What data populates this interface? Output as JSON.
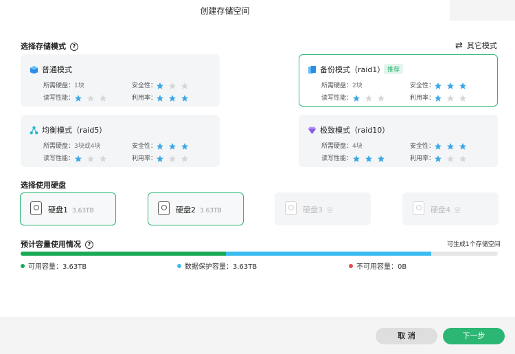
{
  "dialog": {
    "title": "创建存储空间"
  },
  "storage_mode": {
    "label": "选择存储模式",
    "help": "?",
    "other_mode": "其它模式",
    "cards": [
      {
        "name": "普通模式",
        "icon": "cube-icon",
        "selected": false,
        "badge": "",
        "disks_label": "所需硬盘：",
        "disks_value": "1块",
        "security_label": "安全性：",
        "security_stars": 1,
        "rw_label": "读写性能：",
        "rw_stars": 1,
        "util_label": "利用率：",
        "util_stars": 3
      },
      {
        "name": "备份模式（raid1）",
        "icon": "backup-icon",
        "selected": true,
        "badge": "推荐",
        "disks_label": "所需硬盘：",
        "disks_value": "2块",
        "security_label": "安全性：",
        "security_stars": 3,
        "rw_label": "读写性能：",
        "rw_stars": 1,
        "util_label": "利用率：",
        "util_stars": 1
      },
      {
        "name": "均衡模式（raid5）",
        "icon": "network-icon",
        "selected": false,
        "badge": "",
        "disks_label": "所需硬盘：",
        "disks_value": "3块或4块",
        "security_label": "安全性：",
        "security_stars": 3,
        "rw_label": "读写性能：",
        "rw_stars": 1,
        "util_label": "利用率：",
        "util_stars": 1
      },
      {
        "name": "极致模式（raid10）",
        "icon": "gem-icon",
        "selected": false,
        "badge": "",
        "disks_label": "所需硬盘：",
        "disks_value": "4块",
        "security_label": "安全性：",
        "security_stars": 3,
        "rw_label": "读写性能：",
        "rw_stars": 3,
        "util_label": "利用率：",
        "util_stars": 1
      }
    ]
  },
  "disks": {
    "label": "选择使用硬盘",
    "items": [
      {
        "name": "硬盘1",
        "size": "3.63TB",
        "selected": true,
        "empty": false
      },
      {
        "name": "硬盘2",
        "size": "3.63TB",
        "selected": true,
        "empty": false
      },
      {
        "name": "硬盘3",
        "size": "空",
        "selected": false,
        "empty": true
      },
      {
        "name": "硬盘4",
        "size": "空",
        "selected": false,
        "empty": true
      }
    ]
  },
  "capacity": {
    "label": "预计容量使用情况",
    "help": "?",
    "summary": "可生成1个存储空间",
    "segments": [
      {
        "fraction": 0.43,
        "color": "#1aaa55"
      },
      {
        "fraction": 0.43,
        "color": "#3bbbf0"
      }
    ],
    "legend": [
      {
        "text": "可用容量：3.63TB",
        "color": "#1aaa55"
      },
      {
        "text": "数据保护容量：3.63TB",
        "color": "#3bbbf0"
      },
      {
        "text": "不可用容量：0B",
        "color": "#e84b4b"
      }
    ]
  },
  "footer": {
    "cancel": "取 消",
    "next": "下一步"
  },
  "colors": {
    "accent": "#2bb673",
    "star_on": "#3aa8e6",
    "star_off": "#d6d6d6"
  }
}
